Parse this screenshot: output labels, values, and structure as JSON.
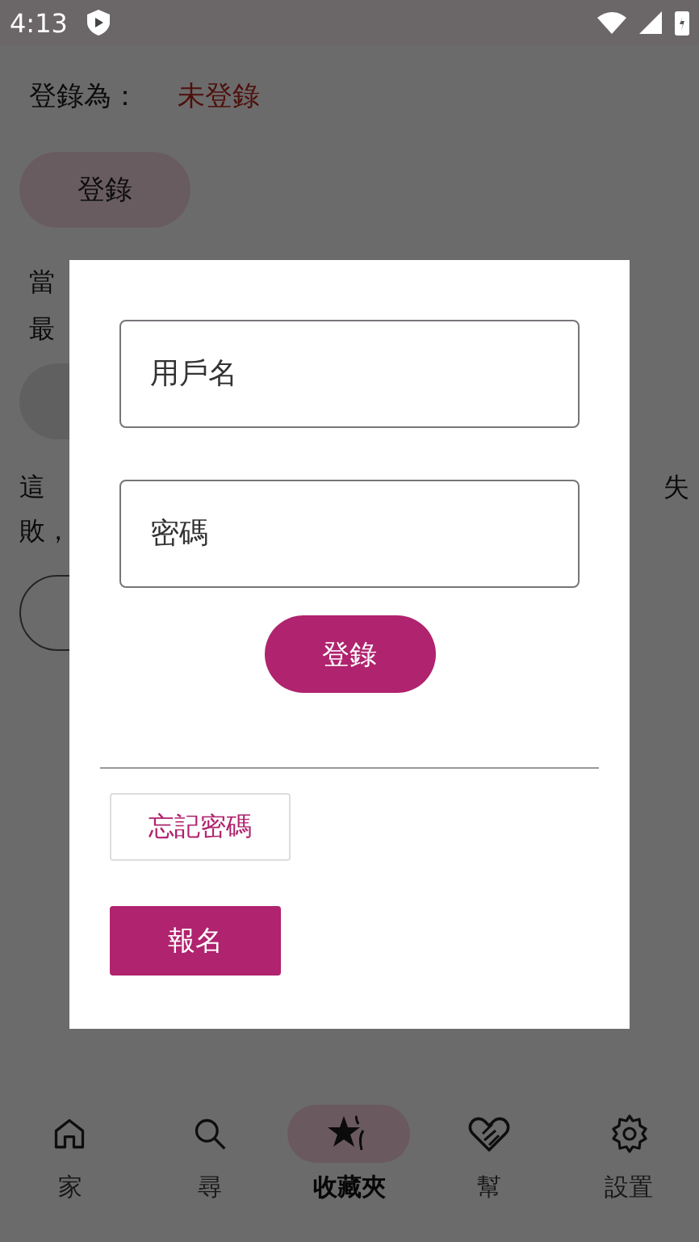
{
  "status_bar": {
    "time": "4:13"
  },
  "account": {
    "label": "登錄為：",
    "status": "未登錄",
    "login_button": "登錄"
  },
  "info_lines": [
    "當",
    "最"
  ],
  "notice": {
    "line1_start": "這",
    "line1_end": "失",
    "line2": "敗，"
  },
  "dialog": {
    "username_placeholder": "用戶名",
    "password_placeholder": "密碼",
    "login_button": "登錄",
    "forgot_password_button": "忘記密碼",
    "signup_button": "報名"
  },
  "nav": [
    {
      "label": "家",
      "kind": "home",
      "selected": false
    },
    {
      "label": "尋",
      "kind": "search",
      "selected": false
    },
    {
      "label": "收藏夾",
      "kind": "favorites",
      "selected": true
    },
    {
      "label": "幫",
      "kind": "help",
      "selected": false
    },
    {
      "label": "設置",
      "kind": "settings",
      "selected": false
    }
  ]
}
